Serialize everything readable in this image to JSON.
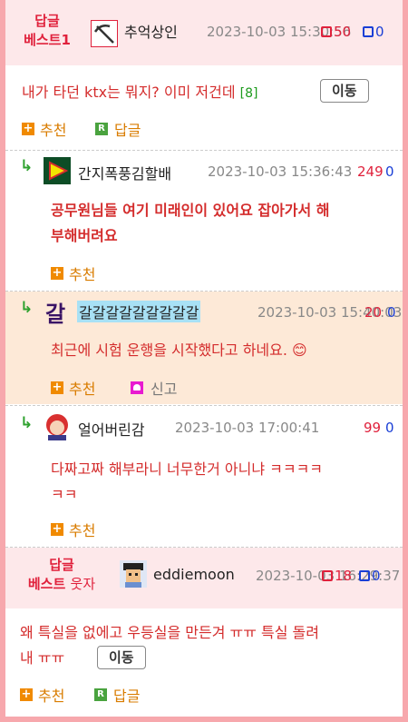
{
  "comments": [
    {
      "badge_line1": "답글",
      "badge_line2": "베스트1",
      "nickname": "추억상인",
      "date": "2023-10-03 15:30:56",
      "up": "50",
      "down": "0",
      "text": "내가 타던 ktx는 뭐지? 이미 저건데",
      "reply_count": "[8]",
      "move_label": "이동",
      "recommend_label": "추천",
      "reply_label": "답글",
      "avatar_icon": "pickaxe-avatar-icon"
    },
    {
      "arrow": "↳",
      "nickname": "간지폭풍김할배",
      "date": "2023-10-03 15:36:43",
      "up": "249",
      "down": "0",
      "text_line1": "공무원님들 여기 미래인이 있어요 잡아가서 해",
      "text_line2": "부해버려요",
      "recommend_label": "추천",
      "avatar_icon": "play-triangle-avatar-icon"
    },
    {
      "arrow": "↳",
      "nickname_glyph": "갈",
      "nickname": "갈갈갈갈갈갈갈갈갈",
      "date": "2023-10-03 15:40:03",
      "up": "20",
      "down": "0",
      "text": "최근에 시험 운행을 시작했다고 하네요. 😊",
      "recommend_label": "추천",
      "report_label": "신고"
    },
    {
      "arrow": "↳",
      "nickname": "얼어버린감",
      "date": "2023-10-03 17:00:41",
      "up": "99",
      "down": "0",
      "text_line1": "다짜고짜 해부라니 너무한거 아니냐 ㅋㅋㅋㅋ",
      "text_line2": "ㅋㅋ",
      "recommend_label": "추천",
      "avatar_icon": "red-hair-girl-avatar-icon"
    },
    {
      "badge_line1": "답글",
      "badge_line2_a": "베스트",
      "badge_line2_b": "웃자",
      "nickname": "eddiemoon",
      "date": "2023-10-03 16:29:37",
      "up": "18",
      "down": "0",
      "text_line1": "왜 특실을 없에고 우등실을 만든겨 ㅠㅠ 특실 돌려",
      "text_line2": "내 ㅠㅠ",
      "move_label": "이동",
      "recommend_label": "추천",
      "reply_label": "답글",
      "avatar_icon": "pixel-man-avatar-icon"
    }
  ],
  "colors": {
    "outer_frame": "#f7a8ad",
    "best_header_bg": "#fde8ea",
    "highlight_comment_bg": "#fde9d7",
    "body_text": "#d42c2c",
    "upvote": "#e0213c",
    "downvote": "#1a3fd6"
  }
}
